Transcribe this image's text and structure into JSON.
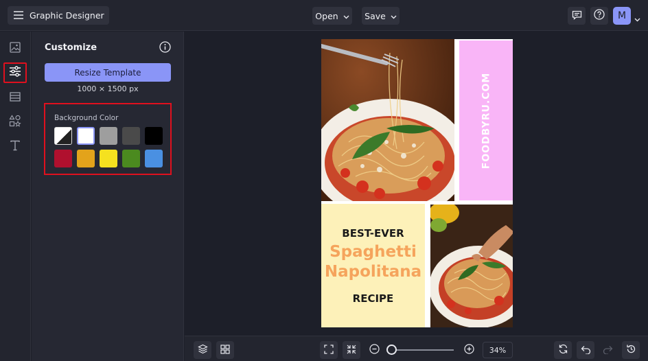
{
  "app": {
    "title": "Graphic Designer"
  },
  "topbar": {
    "open_label": "Open",
    "save_label": "Save",
    "avatar_initial": "M",
    "avatar_color": "#8a95f7"
  },
  "rail": {
    "items": [
      "image-icon",
      "sliders-icon",
      "layout-icon",
      "shapes-icon",
      "text-icon"
    ],
    "active": "sliders-icon"
  },
  "panel": {
    "title": "Customize",
    "resize_label": "Resize Template",
    "resize_color": "#8a95f7",
    "dimensions": "1000 × 1500 px",
    "background_color_label": "Background Color",
    "swatches": [
      "#ffffff",
      "#ffffff",
      "#9e9e9e",
      "#4a4a4a",
      "#000000",
      "#b0102e",
      "#e3a31b",
      "#f5e11f",
      "#4b8a1f",
      "#4a90e2"
    ]
  },
  "design": {
    "vertical_text": "FOODBYRU.COM",
    "best_ever": "BEST-EVER",
    "dish_line1": "Spaghetti",
    "dish_line2": "Napolitana",
    "recipe": "RECIPE",
    "pink": "#f9b5f7",
    "cream": "#fdf1b9",
    "orange": "#f5a45c"
  },
  "bottombar": {
    "zoom": "34%"
  }
}
